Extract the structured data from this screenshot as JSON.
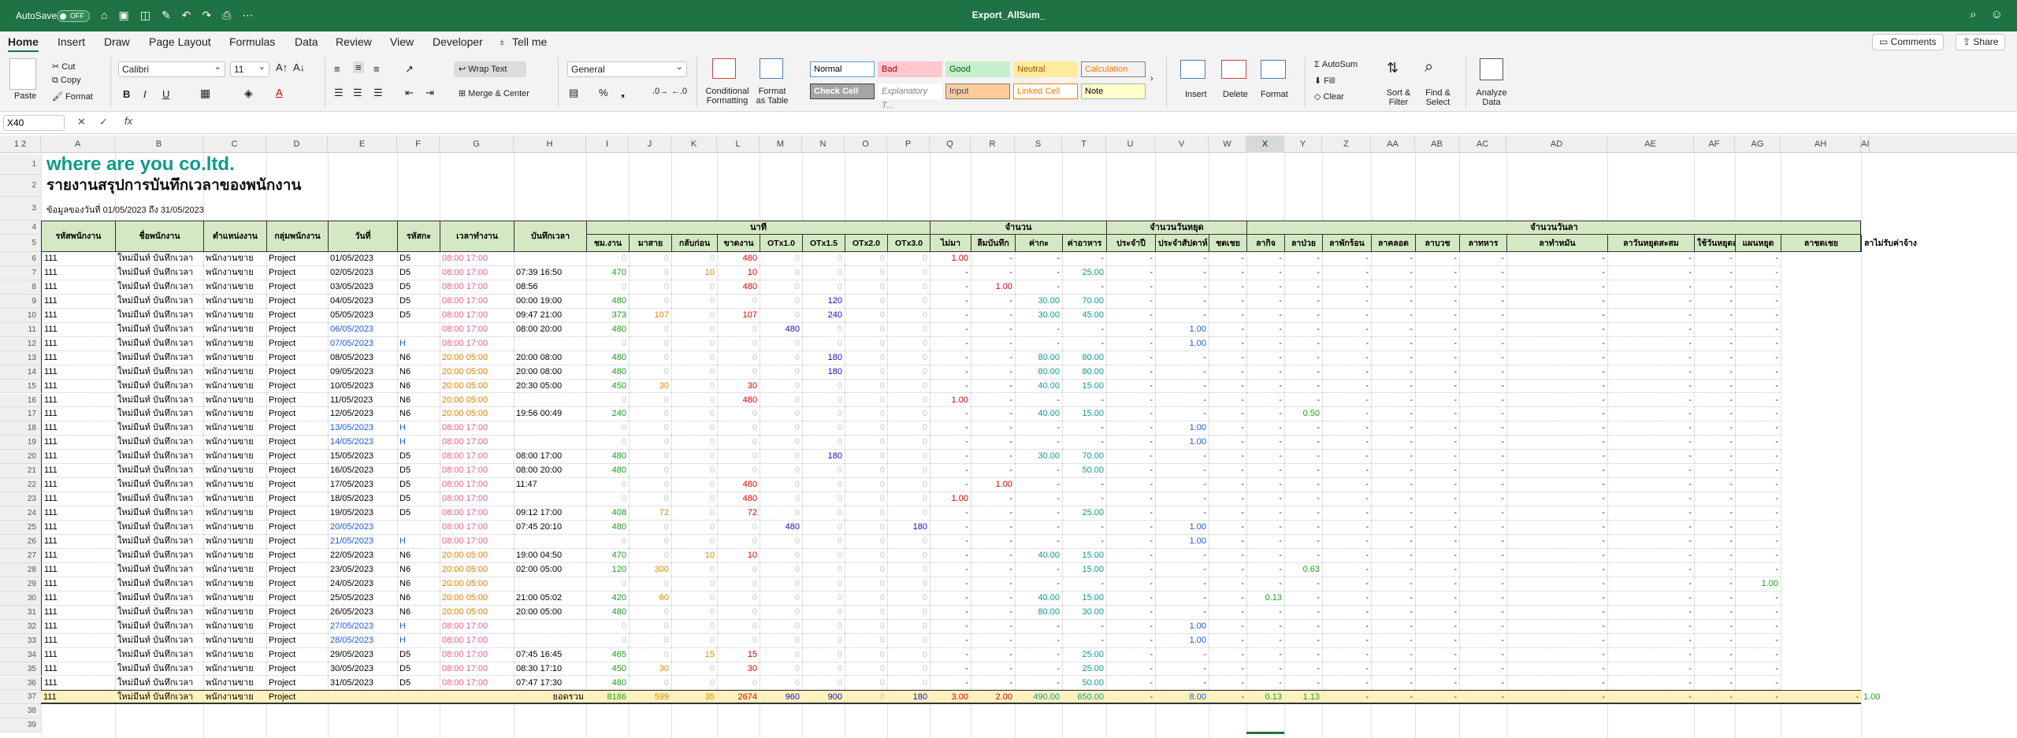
{
  "titlebar": {
    "autosave": "AutoSave",
    "toggle": "OFF",
    "title": "Export_AllSum_"
  },
  "menu": {
    "tabs": [
      "Home",
      "Insert",
      "Draw",
      "Page Layout",
      "Formulas",
      "Data",
      "Review",
      "View",
      "Developer",
      "Tell me"
    ],
    "comments": "Comments",
    "share": "Share"
  },
  "ribbon": {
    "paste": "Paste",
    "cut": "Cut",
    "copy": "Copy",
    "format": "Format",
    "font_name": "Calibri",
    "font_size": "11",
    "wrap_text": "Wrap Text",
    "merge_center": "Merge & Center",
    "number_format": "General",
    "conditional": "Conditional Formatting",
    "format_table": "Format as Table",
    "styles": [
      {
        "label": "Normal",
        "bg": "#ffffff",
        "fg": "#000000",
        "border": "#5b9bd5"
      },
      {
        "label": "Bad",
        "bg": "#ffc7ce",
        "fg": "#9c0006",
        "border": "#ffc7ce"
      },
      {
        "label": "Good",
        "bg": "#c6efce",
        "fg": "#006100",
        "border": "#c6efce"
      },
      {
        "label": "Neutral",
        "bg": "#ffeb9c",
        "fg": "#9c5700",
        "border": "#ffeb9c"
      },
      {
        "label": "Calculation",
        "bg": "#f2f2f2",
        "fg": "#fa7d00",
        "border": "#7f7f7f"
      },
      {
        "label": "Check Cell",
        "bg": "#a5a5a5",
        "fg": "#ffffff",
        "border": "#3f3f3f"
      },
      {
        "label": "Explanatory T...",
        "bg": "#ffffff",
        "fg": "#7f7f7f",
        "border": "#ffffff"
      },
      {
        "label": "Input",
        "bg": "#ffcc99",
        "fg": "#3f3f76",
        "border": "#7f7f7f"
      },
      {
        "label": "Linked Cell",
        "bg": "#ffffff",
        "fg": "#fa7d00",
        "border": "#ff8001"
      },
      {
        "label": "Note",
        "bg": "#ffffcc",
        "fg": "#000000",
        "border": "#b2b2b2"
      }
    ],
    "insert": "Insert",
    "delete": "Delete",
    "format_cells": "Format",
    "autosum": "AutoSum",
    "fill": "Fill",
    "clear": "Clear",
    "sort_filter": "Sort & Filter",
    "find_select": "Find & Select",
    "analyze": "Analyze Data"
  },
  "formula": {
    "namebox": "X40",
    "fx": "fx"
  },
  "columns": [
    "A",
    "B",
    "C",
    "D",
    "E",
    "F",
    "G",
    "H",
    "I",
    "J",
    "K",
    "L",
    "M",
    "N",
    "O",
    "P",
    "Q",
    "R",
    "S",
    "T",
    "U",
    "V",
    "W",
    "X",
    "Y",
    "Z",
    "AA",
    "AB",
    "AC",
    "AD",
    "AE",
    "AF",
    "AG",
    "AH",
    "AI"
  ],
  "sheet": {
    "company": "where are you  co.ltd.",
    "report_title": "รายงานสรุปการบันทึกเวลาของพนักงาน",
    "date_range": "ข้อมูลของวันที่ 01/05/2023 ถึง 31/05/2023",
    "group_headers": {
      "minutes": "นาที",
      "count": "จำนวน",
      "holidays": "จำนวนวันหยุด",
      "leave": "จำนวนวันลา"
    },
    "headers": [
      "รหัสพนักงาน",
      "ชื่อพนักงาน",
      "ตำแหน่งงาน",
      "กลุ่มพนักงาน",
      "วันที่",
      "รหัสกะ",
      "เวลาทำงาน",
      "บันทึกเวลา",
      "ชม.งาน",
      "มาสาย",
      "กลับก่อน",
      "ขาดงาน",
      "OTx1.0",
      "OTx1.5",
      "OTx2.0",
      "OTx3.0",
      "ไม่มา",
      "ลืมบันทึก",
      "ค่ากะ",
      "ค่าอาหาร",
      "ประจำปี",
      "ประจำสัปดาห์",
      "ชดเชย",
      "ลากิจ",
      "ลาป่วย",
      "ลาพักร้อน",
      "ลาคลอด",
      "ลาบวช",
      "ลาทหาร",
      "ลาทำหมัน",
      "ลาวันหยุดสะสม",
      "ใช้วันหยุดสะสม",
      "แผนหยุด",
      "ลาชดเชย",
      "ลาไม่รับค่าจ้าง"
    ],
    "emp": {
      "id": "111",
      "name": "ใหม่มีนท์ บันทึกเวลา",
      "position": "พนักงานขาย",
      "group": "Project"
    },
    "rows": [
      [
        "01/05/2023",
        "D5",
        "08:00 17:00",
        "",
        "0",
        "0",
        "0",
        "480",
        "0",
        "0",
        "0",
        "0",
        "1.00",
        "-",
        "-",
        "-",
        "-",
        "-",
        "-",
        "-",
        "-",
        "-",
        "-",
        "-",
        "-",
        "-",
        "-",
        "-",
        "-"
      ],
      [
        "02/05/2023",
        "D5",
        "08:00 17:00",
        "07:39 16:50",
        "470",
        "0",
        "10",
        "10",
        "0",
        "0",
        "0",
        "0",
        "-",
        "-",
        "-",
        "25.00",
        "-",
        "-",
        "-",
        "-",
        "-",
        "-",
        "-",
        "-",
        "-",
        "-",
        "-",
        "-",
        "-"
      ],
      [
        "03/05/2023",
        "D5",
        "08:00 17:00",
        "08:56",
        "0",
        "0",
        "0",
        "480",
        "0",
        "0",
        "0",
        "0",
        "-",
        "1.00",
        "-",
        "-",
        "-",
        "-",
        "-",
        "-",
        "-",
        "-",
        "-",
        "-",
        "-",
        "-",
        "-",
        "-",
        "-"
      ],
      [
        "04/05/2023",
        "D5",
        "08:00 17:00",
        "00:00 19:00",
        "480",
        "0",
        "0",
        "0",
        "0",
        "120",
        "0",
        "0",
        "-",
        "-",
        "30.00",
        "70.00",
        "-",
        "-",
        "-",
        "-",
        "-",
        "-",
        "-",
        "-",
        "-",
        "-",
        "-",
        "-",
        "-"
      ],
      [
        "05/05/2023",
        "D5",
        "08:00 17:00",
        "09:47 21:00",
        "373",
        "107",
        "0",
        "107",
        "0",
        "240",
        "0",
        "0",
        "-",
        "-",
        "30.00",
        "45.00",
        "-",
        "-",
        "-",
        "-",
        "-",
        "-",
        "-",
        "-",
        "-",
        "-",
        "-",
        "-",
        "-"
      ],
      [
        "06/05/2023",
        "",
        "08:00 17:00",
        "08:00 20:00",
        "480",
        "0",
        "0",
        "0",
        "480",
        "0",
        "0",
        "0",
        "-",
        "-",
        "-",
        "-",
        "-",
        "1.00",
        "-",
        "-",
        "-",
        "-",
        "-",
        "-",
        "-",
        "-",
        "-",
        "-",
        "-"
      ],
      [
        "07/05/2023",
        "H",
        "08:00 17:00",
        "",
        "0",
        "0",
        "0",
        "0",
        "0",
        "0",
        "0",
        "0",
        "-",
        "-",
        "-",
        "-",
        "-",
        "1.00",
        "-",
        "-",
        "-",
        "-",
        "-",
        "-",
        "-",
        "-",
        "-",
        "-",
        "-"
      ],
      [
        "08/05/2023",
        "N6",
        "20:00 05:00",
        "20:00 08:00",
        "480",
        "0",
        "0",
        "0",
        "0",
        "180",
        "0",
        "0",
        "-",
        "-",
        "80.00",
        "80.00",
        "-",
        "-",
        "-",
        "-",
        "-",
        "-",
        "-",
        "-",
        "-",
        "-",
        "-",
        "-",
        "-"
      ],
      [
        "09/05/2023",
        "N6",
        "20:00 05:00",
        "20:00 08:00",
        "480",
        "0",
        "0",
        "0",
        "0",
        "180",
        "0",
        "0",
        "-",
        "-",
        "80.00",
        "80.00",
        "-",
        "-",
        "-",
        "-",
        "-",
        "-",
        "-",
        "-",
        "-",
        "-",
        "-",
        "-",
        "-"
      ],
      [
        "10/05/2023",
        "N6",
        "20:00 05:00",
        "20:30 05:00",
        "450",
        "30",
        "0",
        "30",
        "0",
        "0",
        "0",
        "0",
        "-",
        "-",
        "40.00",
        "15.00",
        "-",
        "-",
        "-",
        "-",
        "-",
        "-",
        "-",
        "-",
        "-",
        "-",
        "-",
        "-",
        "-"
      ],
      [
        "11/05/2023",
        "N6",
        "20:00 05:00",
        "",
        "0",
        "0",
        "0",
        "480",
        "0",
        "0",
        "0",
        "0",
        "1.00",
        "-",
        "-",
        "-",
        "-",
        "-",
        "-",
        "-",
        "-",
        "-",
        "-",
        "-",
        "-",
        "-",
        "-",
        "-",
        "-"
      ],
      [
        "12/05/2023",
        "N6",
        "20:00 05:00",
        "19:56 00:49",
        "240",
        "0",
        "0",
        "0",
        "0",
        "0",
        "0",
        "0",
        "-",
        "-",
        "40.00",
        "15.00",
        "-",
        "-",
        "-",
        "-",
        "0.50",
        "-",
        "-",
        "-",
        "-",
        "-",
        "-",
        "-",
        "-"
      ],
      [
        "13/05/2023",
        "H",
        "08:00 17:00",
        "",
        "0",
        "0",
        "0",
        "0",
        "0",
        "0",
        "0",
        "0",
        "-",
        "-",
        "-",
        "-",
        "-",
        "1.00",
        "-",
        "-",
        "-",
        "-",
        "-",
        "-",
        "-",
        "-",
        "-",
        "-",
        "-"
      ],
      [
        "14/05/2023",
        "H",
        "08:00 17:00",
        "",
        "0",
        "0",
        "0",
        "0",
        "0",
        "0",
        "0",
        "0",
        "-",
        "-",
        "-",
        "-",
        "-",
        "1.00",
        "-",
        "-",
        "-",
        "-",
        "-",
        "-",
        "-",
        "-",
        "-",
        "-",
        "-"
      ],
      [
        "15/05/2023",
        "D5",
        "08:00 17:00",
        "08:00 17:00",
        "480",
        "0",
        "0",
        "0",
        "0",
        "180",
        "0",
        "0",
        "-",
        "-",
        "30.00",
        "70.00",
        "-",
        "-",
        "-",
        "-",
        "-",
        "-",
        "-",
        "-",
        "-",
        "-",
        "-",
        "-",
        "-"
      ],
      [
        "16/05/2023",
        "D5",
        "08:00 17:00",
        "08:00 20:00",
        "480",
        "0",
        "0",
        "0",
        "0",
        "0",
        "0",
        "0",
        "-",
        "-",
        "-",
        "50.00",
        "-",
        "-",
        "-",
        "-",
        "-",
        "-",
        "-",
        "-",
        "-",
        "-",
        "-",
        "-",
        "-"
      ],
      [
        "17/05/2023",
        "D5",
        "08:00 17:00",
        "11:47",
        "0",
        "0",
        "0",
        "480",
        "0",
        "0",
        "0",
        "0",
        "-",
        "1.00",
        "-",
        "-",
        "-",
        "-",
        "-",
        "-",
        "-",
        "-",
        "-",
        "-",
        "-",
        "-",
        "-",
        "-",
        "-"
      ],
      [
        "18/05/2023",
        "D5",
        "08:00 17:00",
        "",
        "0",
        "0",
        "0",
        "480",
        "0",
        "0",
        "0",
        "0",
        "1.00",
        "-",
        "-",
        "-",
        "-",
        "-",
        "-",
        "-",
        "-",
        "-",
        "-",
        "-",
        "-",
        "-",
        "-",
        "-",
        "-"
      ],
      [
        "19/05/2023",
        "D5",
        "08:00 17:00",
        "09:12 17:00",
        "408",
        "72",
        "0",
        "72",
        "0",
        "0",
        "0",
        "0",
        "-",
        "-",
        "-",
        "25.00",
        "-",
        "-",
        "-",
        "-",
        "-",
        "-",
        "-",
        "-",
        "-",
        "-",
        "-",
        "-",
        "-"
      ],
      [
        "20/05/2023",
        "",
        "08:00 17:00",
        "07:45 20:10",
        "480",
        "0",
        "0",
        "0",
        "480",
        "0",
        "0",
        "180",
        "-",
        "-",
        "-",
        "-",
        "-",
        "1.00",
        "-",
        "-",
        "-",
        "-",
        "-",
        "-",
        "-",
        "-",
        "-",
        "-",
        "-"
      ],
      [
        "21/05/2023",
        "H",
        "08:00 17:00",
        "",
        "0",
        "0",
        "0",
        "0",
        "0",
        "0",
        "0",
        "0",
        "-",
        "-",
        "-",
        "-",
        "-",
        "1.00",
        "-",
        "-",
        "-",
        "-",
        "-",
        "-",
        "-",
        "-",
        "-",
        "-",
        "-"
      ],
      [
        "22/05/2023",
        "N6",
        "20:00 05:00",
        "19:00 04:50",
        "470",
        "0",
        "10",
        "10",
        "0",
        "0",
        "0",
        "0",
        "-",
        "-",
        "40.00",
        "15.00",
        "-",
        "-",
        "-",
        "-",
        "-",
        "-",
        "-",
        "-",
        "-",
        "-",
        "-",
        "-",
        "-"
      ],
      [
        "23/05/2023",
        "N6",
        "20:00 05:00",
        "02:00 05:00",
        "120",
        "300",
        "0",
        "0",
        "0",
        "0",
        "0",
        "0",
        "-",
        "-",
        "-",
        "15.00",
        "-",
        "-",
        "-",
        "-",
        "0.63",
        "-",
        "-",
        "-",
        "-",
        "-",
        "-",
        "-",
        "-"
      ],
      [
        "24/05/2023",
        "N6",
        "20:00 05:00",
        "",
        "0",
        "0",
        "0",
        "0",
        "0",
        "0",
        "0",
        "0",
        "-",
        "-",
        "-",
        "-",
        "-",
        "-",
        "-",
        "-",
        "-",
        "-",
        "-",
        "-",
        "-",
        "-",
        "-",
        "-",
        "1.00"
      ],
      [
        "25/05/2023",
        "N6",
        "20:00 05:00",
        "21:00 05:02",
        "420",
        "60",
        "0",
        "0",
        "0",
        "0",
        "0",
        "0",
        "-",
        "-",
        "40.00",
        "15.00",
        "-",
        "-",
        "-",
        "0.13",
        "-",
        "-",
        "-",
        "-",
        "-",
        "-",
        "-",
        "-",
        "-"
      ],
      [
        "26/05/2023",
        "N6",
        "20:00 05:00",
        "20:00 05:00",
        "480",
        "0",
        "0",
        "0",
        "0",
        "0",
        "0",
        "0",
        "-",
        "-",
        "80.00",
        "30.00",
        "-",
        "-",
        "-",
        "-",
        "-",
        "-",
        "-",
        "-",
        "-",
        "-",
        "-",
        "-",
        "-"
      ],
      [
        "27/05/2023",
        "H",
        "08:00 17:00",
        "",
        "0",
        "0",
        "0",
        "0",
        "0",
        "0",
        "0",
        "0",
        "-",
        "-",
        "-",
        "-",
        "-",
        "1.00",
        "-",
        "-",
        "-",
        "-",
        "-",
        "-",
        "-",
        "-",
        "-",
        "-",
        "-"
      ],
      [
        "28/05/2023",
        "H",
        "08:00 17:00",
        "",
        "0",
        "0",
        "0",
        "0",
        "0",
        "0",
        "0",
        "0",
        "-",
        "-",
        "-",
        "-",
        "-",
        "1.00",
        "-",
        "-",
        "-",
        "-",
        "-",
        "-",
        "-",
        "-",
        "-",
        "-",
        "-"
      ],
      [
        "29/05/2023",
        "D5",
        "08:00 17:00",
        "07:45 16:45",
        "465",
        "0",
        "15",
        "15",
        "0",
        "0",
        "0",
        "0",
        "-",
        "-",
        "-",
        "25.00",
        "-",
        "-",
        "-",
        "-",
        "-",
        "-",
        "-",
        "-",
        "-",
        "-",
        "-",
        "-",
        "-"
      ],
      [
        "30/05/2023",
        "D5",
        "08:00 17:00",
        "08:30 17:10",
        "450",
        "30",
        "0",
        "30",
        "0",
        "0",
        "0",
        "0",
        "-",
        "-",
        "-",
        "25.00",
        "-",
        "-",
        "-",
        "-",
        "-",
        "-",
        "-",
        "-",
        "-",
        "-",
        "-",
        "-",
        "-"
      ],
      [
        "31/05/2023",
        "D5",
        "08:00 17:00",
        "07:47 17:30",
        "480",
        "0",
        "0",
        "0",
        "0",
        "0",
        "0",
        "0",
        "-",
        "-",
        "-",
        "50.00",
        "-",
        "-",
        "-",
        "-",
        "-",
        "-",
        "-",
        "-",
        "-",
        "-",
        "-",
        "-",
        "-"
      ]
    ],
    "total": {
      "label": "ยอดรวม",
      "values": [
        "8186",
        "599",
        "35",
        "2674",
        "960",
        "900",
        "0",
        "180",
        "3.00",
        "2.00",
        "490.00",
        "650.00",
        "-",
        "8.00",
        "-",
        "0.13",
        "1.13",
        "-",
        "-",
        "-",
        "-",
        "-",
        "-",
        "-",
        "-",
        "-",
        "1.00"
      ]
    }
  }
}
